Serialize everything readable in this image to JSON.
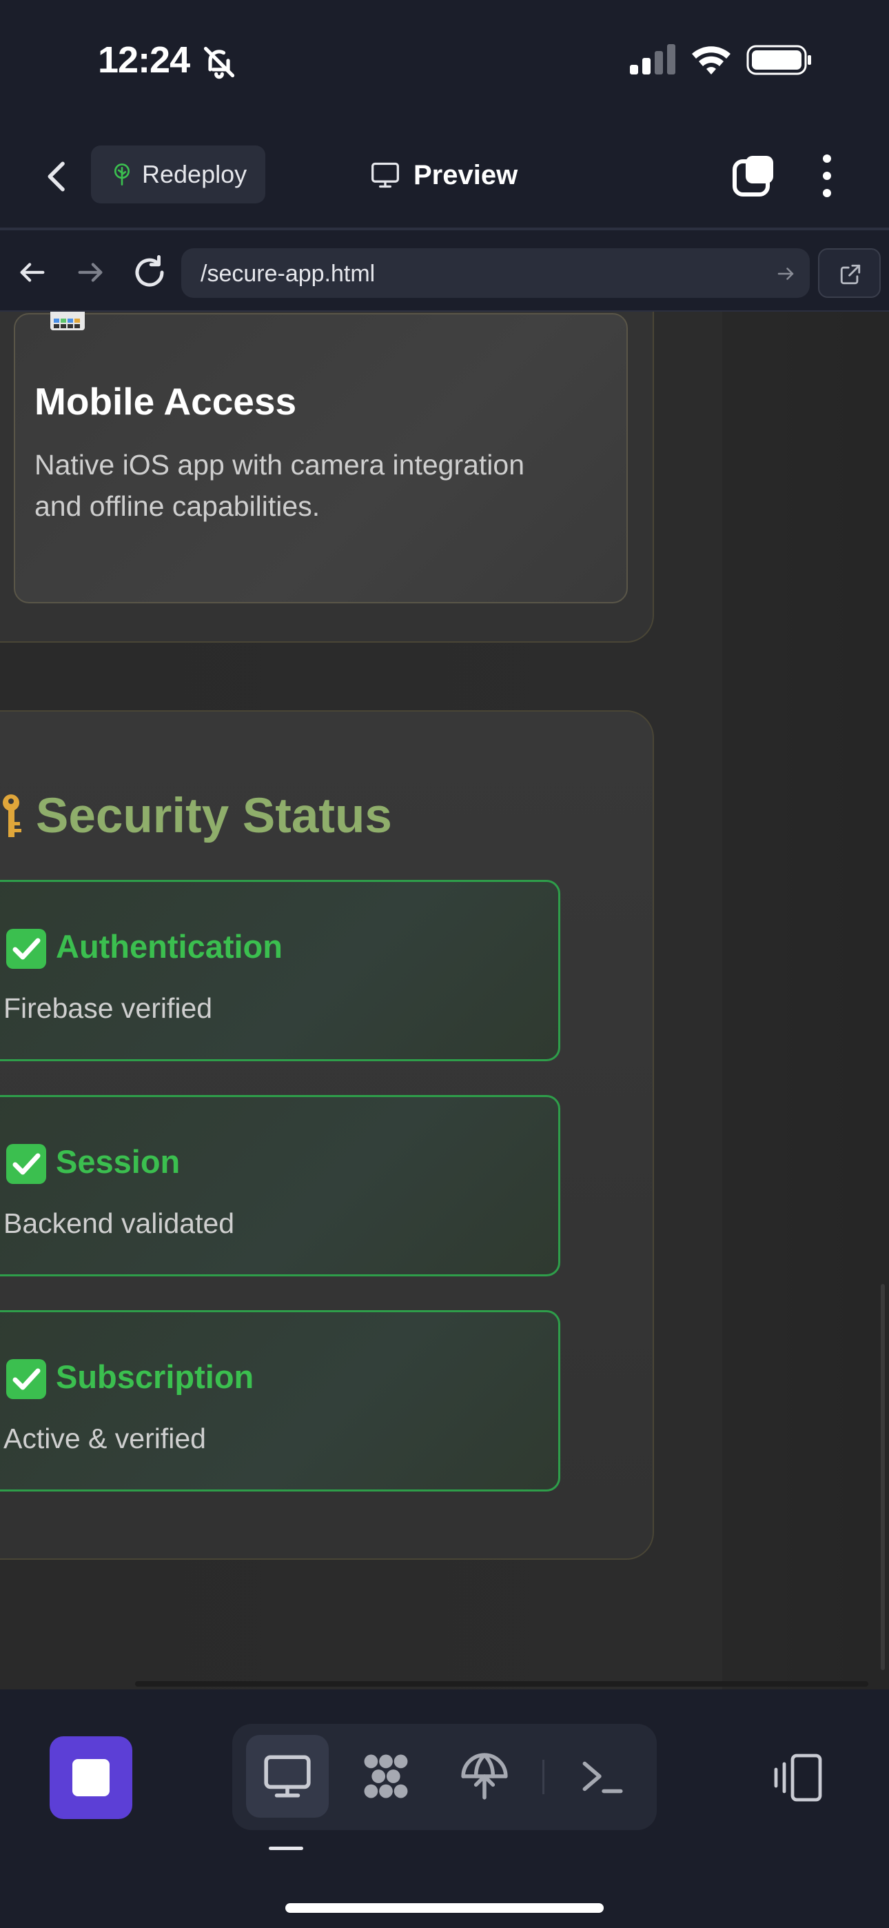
{
  "status_bar": {
    "time": "12:24"
  },
  "header": {
    "redeploy_label": "Redeploy",
    "preview_label": "Preview"
  },
  "browser": {
    "url": "/secure-app.html"
  },
  "feature_card": {
    "title": "Mobile Access",
    "description": "Native iOS app with camera integration and offline capabilities."
  },
  "security": {
    "title": "Security Status",
    "items": [
      {
        "name": "Authentication",
        "detail": "Firebase verified"
      },
      {
        "name": "Session",
        "detail": "Backend validated"
      },
      {
        "name": "Subscription",
        "detail": "Active & verified"
      }
    ]
  },
  "colors": {
    "accent_purple": "#5c3fd6",
    "status_green": "#3bbf4f",
    "heading_green": "#8fae6b",
    "background": "#1b1e2a"
  },
  "icons": [
    "bell-slash-icon",
    "signal-icon",
    "wifi-icon",
    "battery-icon",
    "chevron-left-icon",
    "tree-icon",
    "monitor-icon",
    "tabs-icon",
    "more-vertical-icon",
    "arrow-left-icon",
    "arrow-right-icon",
    "reload-icon",
    "external-link-icon",
    "key-icon",
    "check-icon",
    "stop-icon",
    "grid-icon",
    "deploy-icon",
    "terminal-icon",
    "device-toggle-icon"
  ]
}
